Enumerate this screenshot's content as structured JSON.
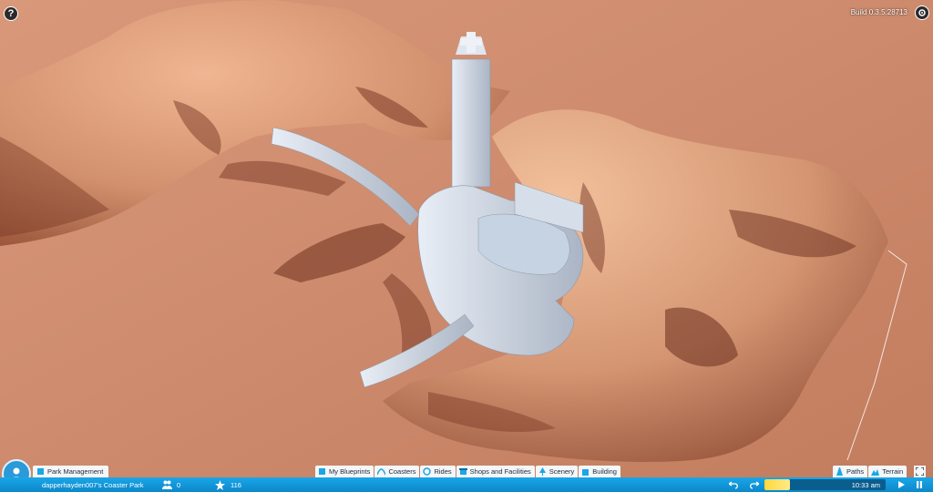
{
  "top": {
    "help_icon": "?",
    "build_label": "Build 0.3.5.28713"
  },
  "tabs": {
    "park_management": "Park Management",
    "main": [
      "My Blueprints",
      "Coasters",
      "Rides",
      "Shops and Facilities",
      "Scenery",
      "Building"
    ],
    "right": [
      "Paths",
      "Terrain"
    ]
  },
  "status": {
    "park_name": "dapperhayden007's Coaster Park",
    "guests": "0",
    "rating": "116",
    "time": "10:33 am"
  },
  "colors": {
    "accent": "#1aa6e8",
    "terrain": "#c8876a",
    "tab_bg": "#f4f6f8"
  },
  "icons": [
    "help-icon",
    "gear-icon",
    "avatar-icon",
    "guests-icon",
    "star-icon",
    "undo-icon",
    "redo-icon",
    "pause-icon",
    "play-icon"
  ]
}
